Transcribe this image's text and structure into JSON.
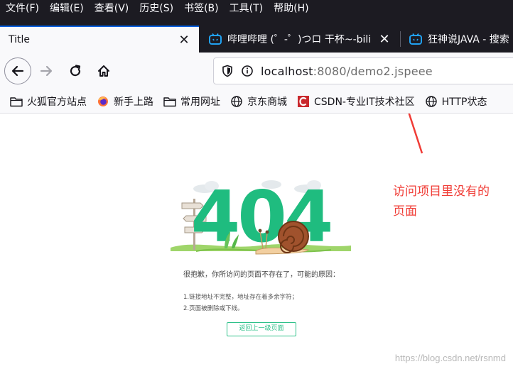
{
  "menu": [
    "文件(F)",
    "编辑(E)",
    "查看(V)",
    "历史(S)",
    "书签(B)",
    "工具(T)",
    "帮助(H)"
  ],
  "tabs": [
    {
      "label": "Title",
      "active": true,
      "icon": "none"
    },
    {
      "label": "哔哩哔哩 (゜-゜)つロ 干杯~-bili",
      "active": false,
      "icon": "bilibili-icon"
    },
    {
      "label": "狂神说JAVA - 搜索",
      "active": false,
      "icon": "bilibili-icon"
    }
  ],
  "url": {
    "host": "localhost",
    "rest": ":8080/demo2.jspeee"
  },
  "bookmarks": [
    {
      "label": "火狐官方站点",
      "icon": "folder-icon"
    },
    {
      "label": "新手上路",
      "icon": "firefox-icon"
    },
    {
      "label": "常用网址",
      "icon": "folder-icon"
    },
    {
      "label": "京东商城",
      "icon": "globe-icon"
    },
    {
      "label": "CSDN-专业IT技术社区",
      "icon": "csdn-icon"
    },
    {
      "label": "HTTP状态",
      "icon": "globe-icon"
    }
  ],
  "annotation": {
    "line1": "访问项目里没有的",
    "line2": "页面"
  },
  "error_page": {
    "code": "404",
    "message": "很抱歉，你所访问的页面不存在了，可能的原因：",
    "reasons": [
      "1.链接地址不完整，地址存在着多余字符；",
      "2.页面被删除或下线。"
    ],
    "back_link": "返回上一级页面"
  },
  "watermark": "https://blog.csdn.net/rsnmd",
  "colors": {
    "chrome_dark": "#1c1b22",
    "accent": "#0060df",
    "annotation_red": "#f03c36",
    "error_green": "#2fc18a"
  }
}
